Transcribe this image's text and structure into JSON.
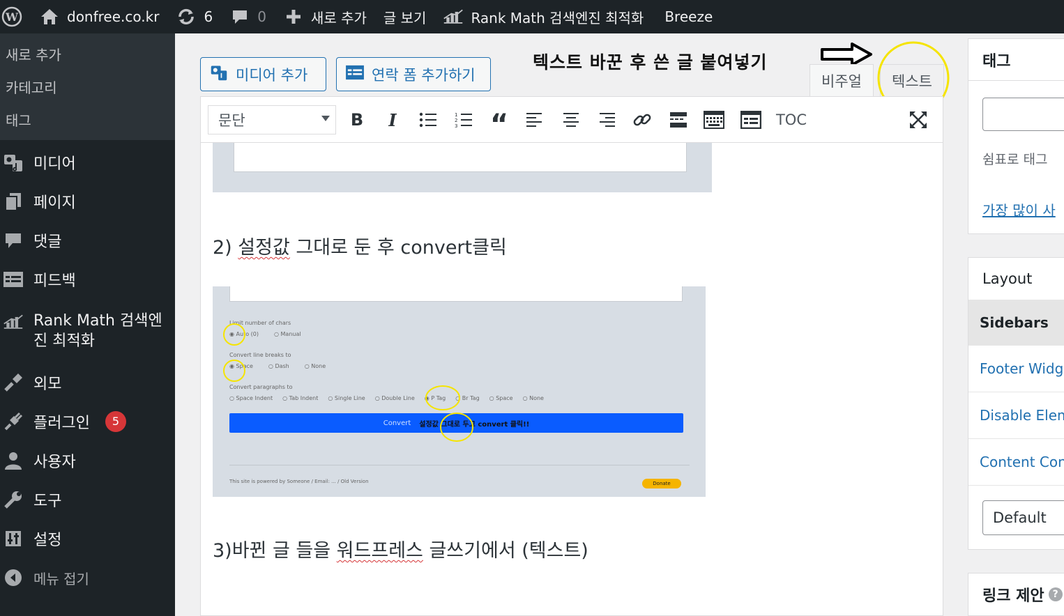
{
  "admin_bar": {
    "site": "donfree.co.kr",
    "updates_count": "6",
    "comments_count": "0",
    "new_label": "새로 추가",
    "view_post": "글 보기",
    "rank_math": "Rank Math 검색엔진 최적화",
    "breeze": "Breeze"
  },
  "sidebar": {
    "submenu": [
      "새로 추가",
      "카테고리",
      "태그"
    ],
    "items": [
      {
        "label": "미디어",
        "icon": "media-icon"
      },
      {
        "label": "페이지",
        "icon": "page-icon"
      },
      {
        "label": "댓글",
        "icon": "comment-icon"
      },
      {
        "label": "피드백",
        "icon": "feedback-icon"
      },
      {
        "label": "Rank Math 검색엔진 최적화",
        "line1": "Rank Math 검색엔",
        "line2": "진 최적화",
        "icon": "rankmath-icon"
      },
      {
        "label": "외모",
        "icon": "appearance-icon"
      },
      {
        "label": "플러그인",
        "icon": "plugin-icon",
        "badge": "5"
      },
      {
        "label": "사용자",
        "icon": "user-icon"
      },
      {
        "label": "도구",
        "icon": "tools-icon"
      },
      {
        "label": "설정",
        "icon": "settings-icon"
      }
    ],
    "collapse": "메뉴 접기"
  },
  "editor": {
    "add_media": "미디어 추가",
    "add_contact_form": "연락 폼 추가하기",
    "annotation": "텍스트 바꾼 후 쓴 글 붙여넣기",
    "tab_visual": "비주얼",
    "tab_text": "텍스트",
    "format_select": "문단",
    "toc_label": "TOC",
    "para2_prefix": "2) ",
    "para2_misspelled": "설정값",
    "para2_rest": " 그대로 둔 후 convert클릭",
    "para3_prefix": "3)바뀐 글 들을 ",
    "para3_misspelled": "워드프레스",
    "para3_rest": " 글쓰기에서 (텍스트)"
  },
  "screenshot2": {
    "opt1_label": "Limit number of chars",
    "opt1_values": [
      "Auto (0)",
      "Manual"
    ],
    "opt2_label": "Convert line breaks to",
    "opt2_values": [
      "Space",
      "Dash",
      "None"
    ],
    "opt3_label": "Convert paragraphs to",
    "opt3_values": [
      "Space Indent",
      "Tab Indent",
      "Single Line",
      "Double Line",
      "P Tag",
      "Br Tag",
      "Space",
      "None"
    ],
    "convert_button": "Convert",
    "convert_note": "설정값 그대로 두고 convert 클릭!!",
    "footer": "This site is powered by Someone / Email: ... / Old Version",
    "donate": "Donate"
  },
  "right_panel": {
    "tags_title": "태그",
    "tags_hint": "쉼표로 태그",
    "tags_link": "가장 많이 사",
    "layout_title": "Layout",
    "layout_items": [
      "Sidebars",
      "Footer Widge",
      "Disable Elem",
      "Content Con"
    ],
    "layout_select": "Default",
    "link_suggest_title": "링크 제안"
  },
  "colors": {
    "admin_bg": "#1d2327",
    "accent": "#2271b1",
    "badge": "#d63638",
    "highlight": "#f5e400",
    "convert_blue": "#0a5cff"
  }
}
